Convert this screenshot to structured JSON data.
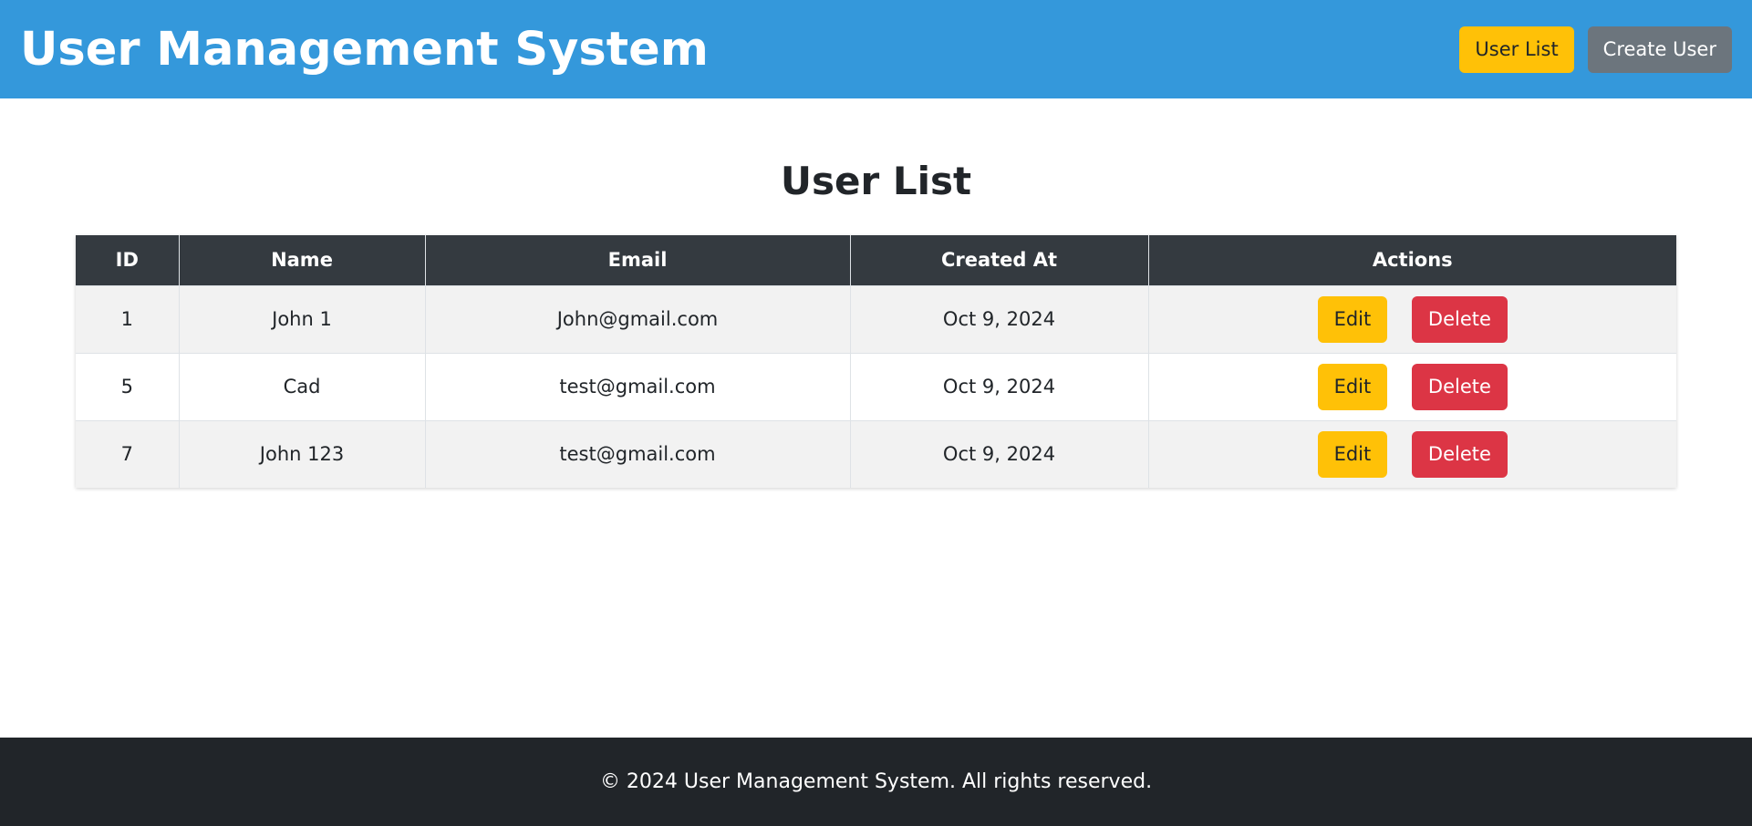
{
  "header": {
    "title": "User Management System",
    "nav": {
      "user_list_label": "User List",
      "create_user_label": "Create User"
    }
  },
  "main": {
    "title": "User List",
    "table": {
      "columns": [
        "ID",
        "Name",
        "Email",
        "Created At",
        "Actions"
      ],
      "rows": [
        {
          "id": "1",
          "name": "John 1",
          "email": "John@gmail.com",
          "created_at": "Oct 9, 2024",
          "edit_label": "Edit",
          "delete_label": "Delete"
        },
        {
          "id": "5",
          "name": "Cad",
          "email": "test@gmail.com",
          "created_at": "Oct 9, 2024",
          "edit_label": "Edit",
          "delete_label": "Delete"
        },
        {
          "id": "7",
          "name": "John 123",
          "email": "test@gmail.com",
          "created_at": "Oct 9, 2024",
          "edit_label": "Edit",
          "delete_label": "Delete"
        }
      ]
    }
  },
  "footer": {
    "text": "© 2024 User Management System. All rights reserved."
  },
  "colors": {
    "header_bg": "#3498db",
    "table_header_bg": "#343a40",
    "edit_button": "#ffc107",
    "delete_button": "#dc3545",
    "create_button": "#6c757d",
    "footer_bg": "#212529"
  }
}
